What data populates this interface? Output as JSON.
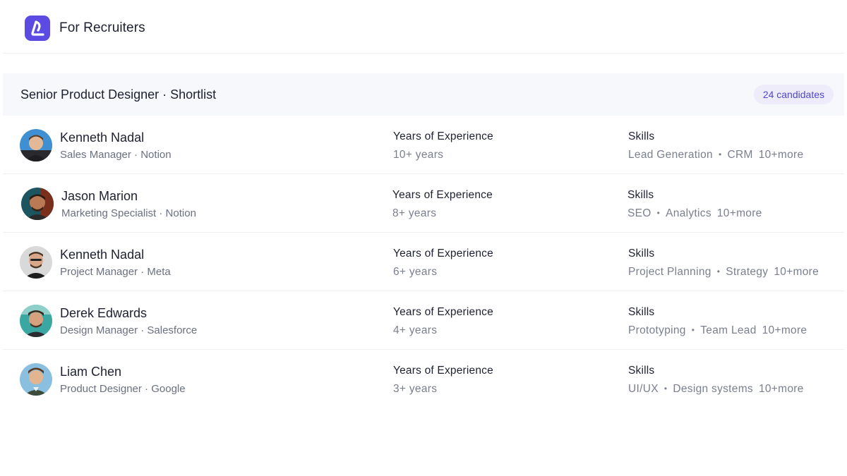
{
  "header": {
    "brand": "For Recruiters",
    "logo_icon": "logo-icon",
    "accent": "#5b4be3"
  },
  "list": {
    "title": "Senior Product Designer · Shortlist",
    "count": "24 candidates"
  },
  "labels": {
    "experience": "Years of Experience",
    "skills": "Skills"
  },
  "candidates": [
    {
      "name": "Kenneth Nadal",
      "role": "Sales Manager · Notion",
      "experience": "10+ years",
      "skill1": "Lead Generation",
      "skill2": "CRM",
      "more": "10+more",
      "avatar_bg": "#3f8fd2"
    },
    {
      "name": "Jason Marion",
      "role": "Marketing Specialist · Notion",
      "experience": "8+ years",
      "skill1": "SEO",
      "skill2": "Analytics",
      "more": "10+more",
      "avatar_bg": "#1c5560"
    },
    {
      "name": "Kenneth Nadal",
      "role": "Project Manager · Meta",
      "experience": "6+ years",
      "skill1": "Project Planning",
      "skill2": "Strategy",
      "more": "10+more",
      "avatar_bg": "#d9d9d9"
    },
    {
      "name": "Derek Edwards",
      "role": "Design Manager · Salesforce",
      "experience": "4+ years",
      "skill1": "Prototyping",
      "skill2": "Team Lead",
      "more": "10+more",
      "avatar_bg": "#3aa7a3"
    },
    {
      "name": "Liam Chen",
      "role": "Product Designer · Google",
      "experience": "3+ years",
      "skill1": "UI/UX",
      "skill2": "Design systems",
      "more": "10+more",
      "avatar_bg": "#8bbfe0"
    }
  ]
}
